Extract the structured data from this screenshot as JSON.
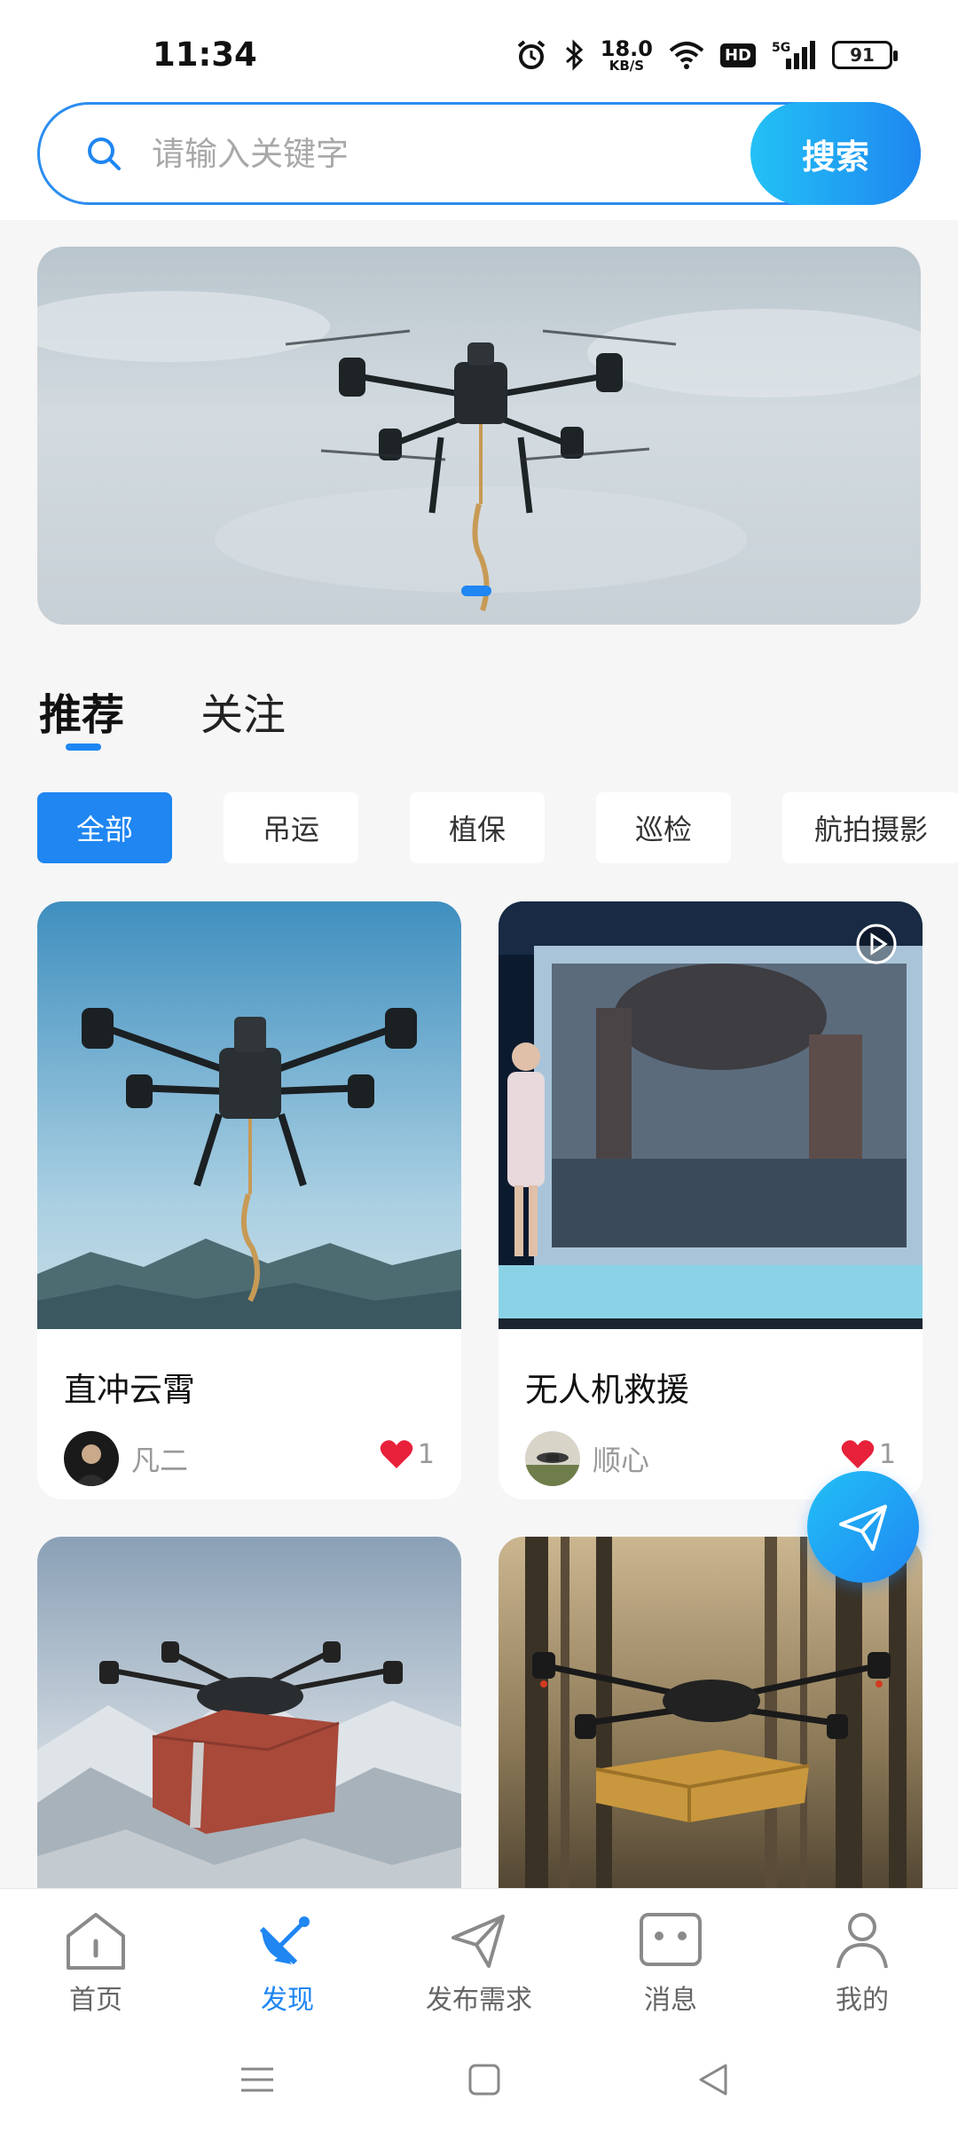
{
  "status_bar": {
    "time": "11:34",
    "net_speed_value": "18.0",
    "net_speed_unit": "KB/S",
    "hd_label": "HD",
    "network_label": "5G",
    "battery": "91"
  },
  "search": {
    "placeholder": "请输入关键字",
    "button_label": "搜索"
  },
  "tabs": [
    {
      "label": "推荐",
      "active": true
    },
    {
      "label": "关注",
      "active": false
    }
  ],
  "categories": [
    {
      "label": "全部",
      "active": true
    },
    {
      "label": "吊运",
      "active": false
    },
    {
      "label": "植保",
      "active": false
    },
    {
      "label": "巡检",
      "active": false
    },
    {
      "label": "航拍摄影",
      "active": false
    }
  ],
  "posts": [
    {
      "title": "直冲云霄",
      "author": "凡二",
      "likes": "1"
    },
    {
      "title": "无人机救援",
      "author": "顺心",
      "likes": "1"
    },
    {
      "title": "",
      "author": "",
      "likes": ""
    },
    {
      "title": "",
      "author": "",
      "likes": ""
    }
  ],
  "bottom_nav": [
    {
      "label": "首页",
      "icon": "home-icon"
    },
    {
      "label": "发现",
      "icon": "discover-icon",
      "active": true
    },
    {
      "label": "发布需求",
      "icon": "send-icon"
    },
    {
      "label": "消息",
      "icon": "message-icon"
    },
    {
      "label": "我的",
      "icon": "user-icon"
    }
  ],
  "colors": {
    "accent": "#1f86f2",
    "accent_light": "#23c1f5",
    "like": "#e8213a"
  }
}
